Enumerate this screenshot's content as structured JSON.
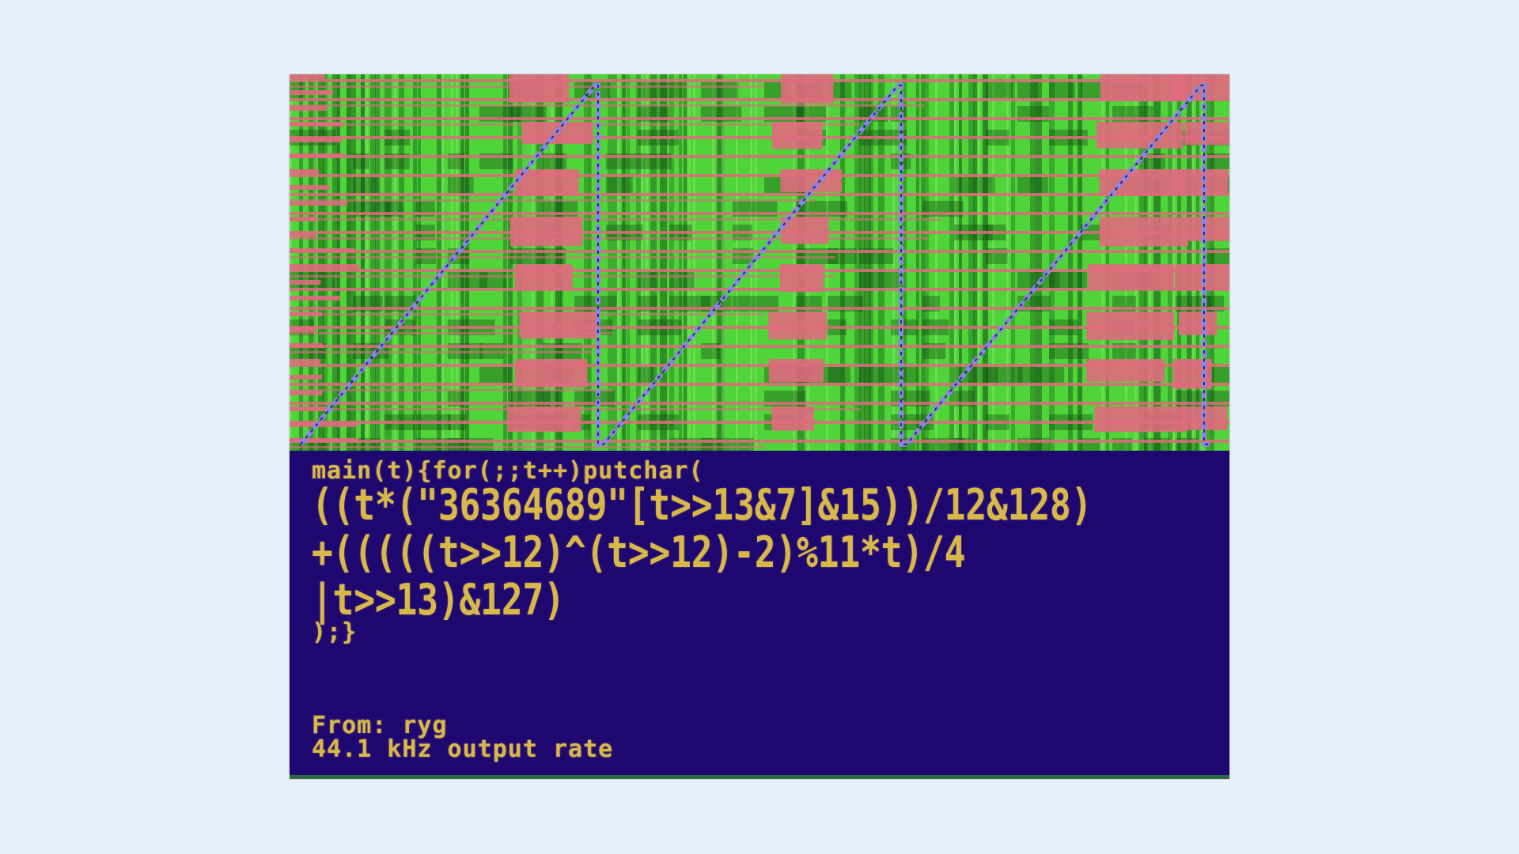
{
  "code": {
    "lines": [
      "main(t){for(;;t++)putchar(",
      "((t*(\"36364689\"[t>>13&7]&15))/12&128)",
      "+(((((t>>12)^(t>>12)-2)%11*t)/4",
      "|t>>13)&127)",
      ");}"
    ]
  },
  "info": {
    "author": "From: ryg",
    "rate": "44.1 kHz output rate"
  },
  "colors": {
    "background": "#e6f0f8",
    "screen": "#1f0770",
    "text": "#d9b84a",
    "green": "#4fd43a",
    "pink": "#e06a7e",
    "waveform": "#8a86e8"
  }
}
